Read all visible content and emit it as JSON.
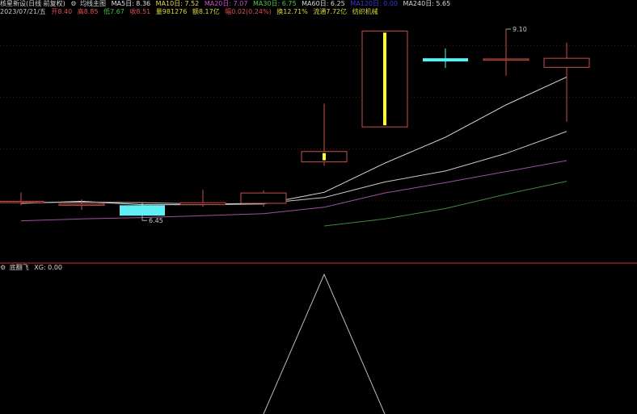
{
  "header": {
    "title": "核星新设(日线 前复权)",
    "indicator_icon": "gear-icon",
    "indicator_name": "均线主图",
    "ma5": "MA5日: 8.36",
    "ma10": "MA10日: 7.52",
    "ma20": "MA20日: 7.07",
    "ma30": "MA30日: 6.75",
    "ma60": "MA60日: 6.25",
    "ma120": "MA120日: 0.00",
    "ma240": "MA240日: 5.65"
  },
  "info": {
    "date": "2023/07/21/五",
    "open": "开8.40",
    "high": "高8.85",
    "low": "低7.67",
    "close": "收8.51",
    "volume": "量981276",
    "amount": "额8.17亿",
    "change": "幅0.02(0.24%)",
    "turnover": "换12.71%",
    "float": "流通7.72亿",
    "industry": "纺织机械"
  },
  "sub": {
    "icon": "gear-icon",
    "name": "底翻飞",
    "xg": "XG: 0.00"
  },
  "colors": {
    "bg": "#000000",
    "up": "#c8504a",
    "down": "#5ff0f5",
    "limit": "#ffff33",
    "ma5": "#dcdcdc",
    "ma10": "#c8c8c8",
    "ma20": "#a050a0",
    "ma30": "#3f8a3f",
    "separator": "#8a2020",
    "grid": "#7a1a1a"
  },
  "chart_data": [
    {
      "type": "candlestick",
      "title": "均线主图",
      "ylim": [
        5.5,
        9.3
      ],
      "candles": [
        {
          "open": 6.42,
          "high": 6.58,
          "low": 6.38,
          "close": 6.44,
          "color": "up"
        },
        {
          "open": 6.38,
          "high": 6.47,
          "low": 6.31,
          "close": 6.4,
          "color": "up"
        },
        {
          "open": 6.38,
          "high": 6.42,
          "low": 6.22,
          "close": 6.22,
          "color": "down"
        },
        {
          "open": 6.39,
          "high": 6.62,
          "low": 6.36,
          "close": 6.42,
          "color": "up"
        },
        {
          "open": 6.41,
          "high": 6.61,
          "low": 6.36,
          "close": 6.57,
          "color": "up"
        },
        {
          "open": 7.21,
          "high": 7.95,
          "low": 6.99,
          "close": 7.05,
          "color": "up",
          "inner": "limit"
        },
        {
          "open": 7.59,
          "high": 9.07,
          "low": 7.59,
          "close": 9.07,
          "color": "up",
          "inner": "limit"
        },
        {
          "open": 8.65,
          "high": 8.8,
          "low": 8.5,
          "close": 8.6,
          "color": "down"
        },
        {
          "open": 8.64,
          "high": 9.1,
          "low": 8.38,
          "close": 8.62,
          "color": "up"
        },
        {
          "open": 8.65,
          "high": 8.89,
          "low": 7.67,
          "close": 8.51,
          "color": "up"
        }
      ],
      "annotations": [
        {
          "label": "6.45",
          "candle": 2,
          "value": 6.22
        },
        {
          "label": "9.10",
          "candle": 8,
          "value": 9.1
        }
      ],
      "series": [
        {
          "key": "ma5",
          "values": [
            6.41,
            6.44,
            6.39,
            6.39,
            6.4,
            6.58,
            7.03,
            7.43,
            7.93,
            8.36
          ]
        },
        {
          "key": "ma10",
          "values": [
            6.42,
            6.43,
            6.42,
            6.4,
            6.41,
            6.5,
            6.74,
            6.91,
            7.18,
            7.52
          ]
        },
        {
          "key": "ma20",
          "values": [
            6.14,
            6.17,
            6.19,
            6.22,
            6.25,
            6.35,
            6.57,
            6.73,
            6.9,
            7.07
          ]
        },
        {
          "key": "ma30",
          "values": [
            null,
            null,
            null,
            null,
            null,
            6.06,
            6.17,
            6.33,
            6.55,
            6.75
          ]
        }
      ]
    },
    {
      "type": "line",
      "title": "底翻飞",
      "ylim": [
        0,
        1
      ],
      "series": [
        {
          "key": "xg",
          "values": [
            null,
            null,
            null,
            null,
            0,
            1,
            0,
            null,
            null,
            null
          ]
        }
      ]
    }
  ]
}
